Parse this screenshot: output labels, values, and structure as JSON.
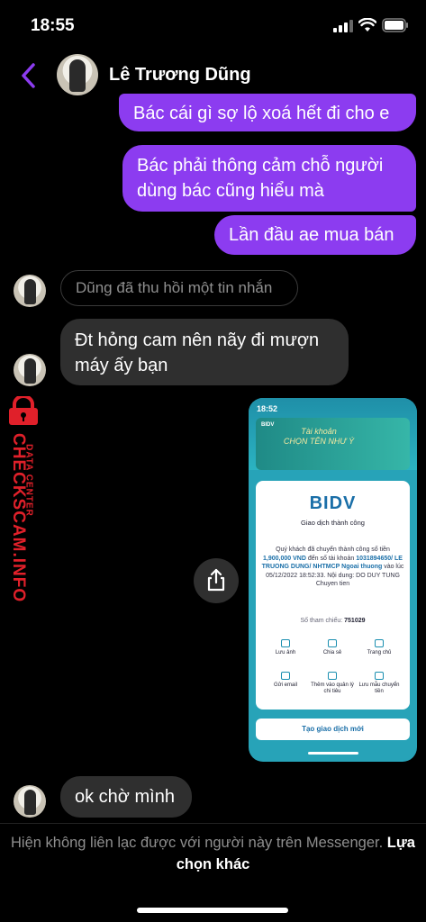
{
  "status_bar": {
    "time": "18:55"
  },
  "header": {
    "contact_name": "Lê Trương Dũng"
  },
  "messages": {
    "sent_1": "Bác cái gì sợ lộ xoá hết đi cho e",
    "sent_2_line1": "Bác phải thông cảm chỗ người",
    "sent_2_line2": "dùng bác cũng hiểu mà",
    "sent_3": "Lần đầu ae mua bán",
    "unsent_notice": "Dũng đã thu hồi một tin nhắn",
    "recv_1_line1": "Đt hỏng cam nên nãy đi mượn",
    "recv_1_line2": "máy ấy bạn",
    "recv_2": "ok chờ mình"
  },
  "watermark": {
    "brand": "CHECKSCAM.INFO",
    "tagline": "DATA CENTER"
  },
  "attachment": {
    "status_time": "18:52",
    "banner_logo": "BIDV",
    "banner_text_1": "Tài khoản",
    "banner_text_2": "CHỌN TÊN NHƯ Ý",
    "bank_logo": "BIDV",
    "success_title": "Giao dịch thành công",
    "detail_1": "Quý khách đã chuyển thành công số tiền",
    "amount": "1,900,000 VND",
    "detail_2": "đến số tài khoản",
    "account": "1031894650/ LE TRUONG DUNG/ NHTMCP Ngoai thuong",
    "detail_3": "vào lúc 05/12/2022 18:52:33. Nội dung: DO DUY TUNG Chuyen tien",
    "ref_label": "Số tham chiếu:",
    "ref_value": "751029",
    "actions": [
      "Lưu ảnh",
      "Chia sẻ",
      "Trang chủ",
      "Gửi email",
      "Thêm vào quản lý chi tiêu",
      "Lưu mẫu chuyển tiền"
    ],
    "new_button": "Tạo giao dịch mới"
  },
  "footer": {
    "notice": "Hiện không liên lạc được với người này trên Messenger.",
    "option_link": "Lựa chọn khác"
  },
  "colors": {
    "sent_bubble": "#8c3cf0",
    "received_bubble": "#2f2f2f",
    "accent": "#8c3cf0",
    "watermark": "#e0202a"
  }
}
